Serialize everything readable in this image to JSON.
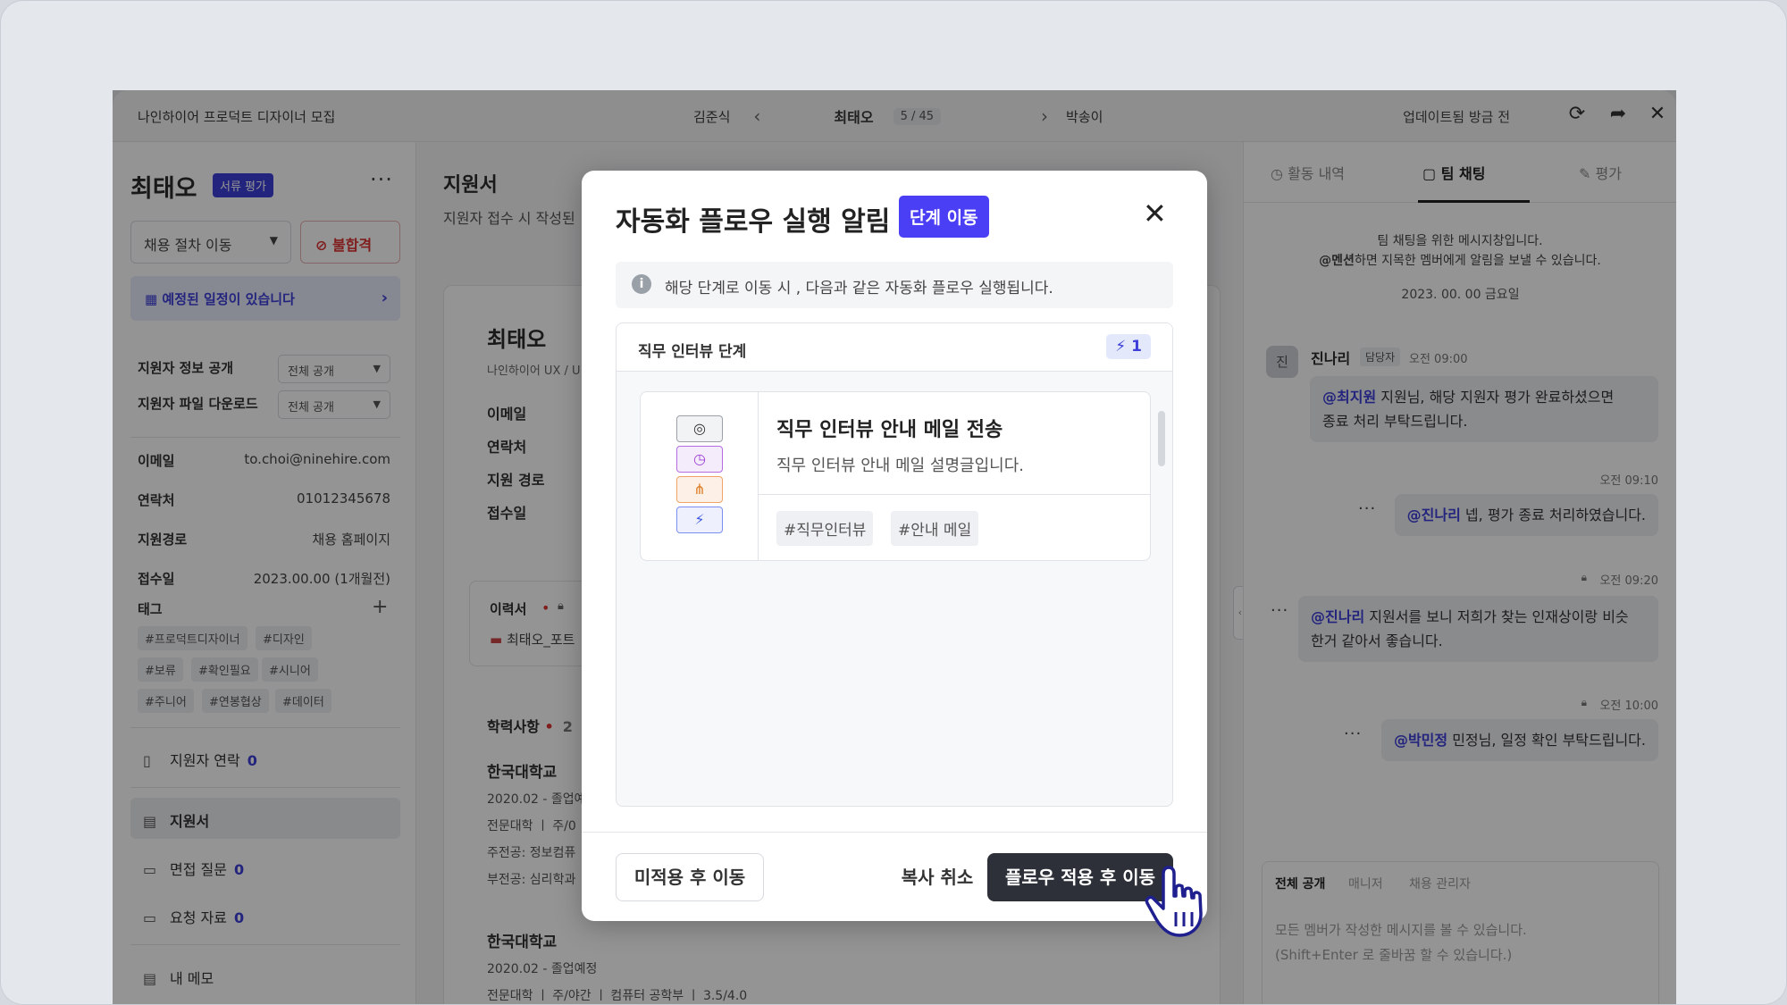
{
  "topbar": {
    "job_title": "나인하이어 프로덕트 디자이너 모집",
    "prev_candidate": "김준식",
    "current_candidate": "최태오",
    "position": "5 / 45",
    "next_candidate": "박송이",
    "updated": "업데이트됨 방금 전",
    "icons": [
      "refresh-icon",
      "share-icon",
      "close-icon"
    ]
  },
  "left": {
    "name": "최태오",
    "stage_badge": "서류 평가",
    "move_select": "채용 절차 이동",
    "reject_label": "불합격",
    "schedule_notice": "예정된 일정이 있습니다",
    "visibility_rows": [
      {
        "label": "지원자 정보 공개",
        "value": "전체 공개"
      },
      {
        "label": "지원자 파일 다운로드",
        "value": "전체 공개"
      }
    ],
    "info": [
      {
        "label": "이메일",
        "value": "to.choi@ninehire.com"
      },
      {
        "label": "연락처",
        "value": "01012345678"
      },
      {
        "label": "지원경로",
        "value": "채용 홈페이지"
      },
      {
        "label": "접수일",
        "value": "2023.00.00 (1개월전)"
      }
    ],
    "tags_label": "태그",
    "tags": [
      "#프로덕트디자이너",
      "#디자인",
      "#보류",
      "#확인필요",
      "#시니어",
      "#주니어",
      "#연봉협상",
      "#데이터"
    ],
    "menu": [
      {
        "label": "지원자 연락",
        "count": "0"
      },
      {
        "label": "지원서",
        "count": ""
      },
      {
        "label": "면접 질문",
        "count": "0"
      },
      {
        "label": "요청 자료",
        "count": "0"
      },
      {
        "label": "내 메모",
        "count": ""
      }
    ]
  },
  "middle": {
    "heading": "지원서",
    "subtext": "지원자 접수 시 작성된",
    "card_name": "최태오",
    "card_dept": "나인하이어 UX / U",
    "info_labels": [
      "이메일",
      "연락처",
      "지원 경로",
      "접수일"
    ],
    "resume_title": "이력서",
    "resume_file": "최태오_포트",
    "education_title": "학력사항",
    "education_count": "2",
    "education": [
      {
        "school": "한국대학교",
        "period": "2020.02 - 졸업예",
        "l1": "전문대학 ㅣ 주/0",
        "l2": "주전공: 정보컴퓨",
        "l3": "부전공: 심리학과"
      },
      {
        "school": "한국대학교",
        "period": "2020.02 - 졸업예정",
        "l1": "전문대학 ㅣ 주/야간 ㅣ 컴퓨터 공학부 ㅣ 3.5/4.0"
      }
    ]
  },
  "right": {
    "tabs": [
      "활동 내역",
      "팀 채팅",
      "평가"
    ],
    "note_line1": "팀 채팅을 위한 메시지창입니다.",
    "note_mention": "@멘션",
    "note_line2": "하면 지목한 멤버에게 알림을 보낼 수 있습니다.",
    "date": "2023. 00. 00 금요일",
    "first_user": "진나리",
    "first_avatar": "진",
    "first_role": "담당자",
    "first_time": "오전 09:00",
    "messages": [
      {
        "mention": "@최지원",
        "text": " 지원님, 해당 지원자 평가 완료하셨으면",
        "text2": "종료 처리 부탁드립니다."
      },
      {
        "time": "오전 09:10",
        "mention": "@진나리",
        "text": " 넵, 평가 종료 처리하였습니다."
      },
      {
        "time": "오전 09:20",
        "mention": "@진나리",
        "text": " 지원서를 보니 저희가 찾는 인재상이랑 비슷",
        "text2": "한거 같아서 좋습니다."
      },
      {
        "time": "오전 10:00",
        "mention": "@박민정",
        "text": " 민정님, 일정 확인 부탁드립니다."
      }
    ],
    "compose_tabs": [
      "전체 공개",
      "매니저",
      "채용 관리자"
    ],
    "compose_line1": "모든 멤버가 작성한 메시지를 볼 수 있습니다.",
    "compose_line2": "(Shift+Enter 로 줄바꿈 할 수 있습니다.)"
  },
  "modal": {
    "title": "자동화 플로우 실행 알림",
    "badge": "단계 이동",
    "info": "해당 단계로 이동 시 , 다음과 같은 자동화 플로우 실행됩니다.",
    "panel_title": "직무 인터뷰 단계",
    "panel_count": "1",
    "flow_title": "직무 인터뷰 안내 메일 전송",
    "flow_desc": "직무 인터뷰 안내 메일 설명글입니다.",
    "flow_tags": [
      "#직무인터뷰",
      "#안내 메일"
    ],
    "btn_skip": "미적용 후 이동",
    "btn_cancel": "복사 취소",
    "btn_apply": "플로우 적용 후 이동",
    "colors": {
      "accent": "#4a3ff5",
      "primary_button": "#2d3038"
    }
  }
}
